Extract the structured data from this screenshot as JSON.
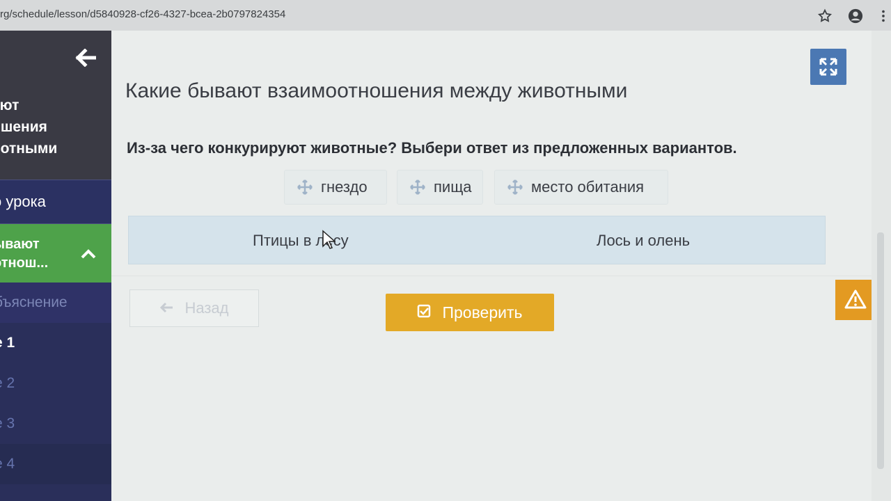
{
  "browser": {
    "url": "rg/schedule/lesson/d5840928-cf26-4327-bcea-2b0797824354",
    "icons": [
      "star-icon",
      "account-icon",
      "menu-icon"
    ]
  },
  "sidebar": {
    "back_icon": "arrow-left-icon",
    "lesson_title_lines": [
      "ают",
      "ошения",
      "вотными"
    ],
    "plan_label": "о урока",
    "active_lines": [
      "ывают",
      "отнош..."
    ],
    "explanation_label": "бъяснение",
    "tasks": [
      "е 1",
      "е 2",
      "е 3",
      "е 4"
    ]
  },
  "main": {
    "heading": "Какие бывают взаимоотношения между животными",
    "question": "Из-за чего конкурируют животные? Выбери ответ из предложенных вариантов.",
    "chips": [
      "гнездо",
      "пища",
      "место обитания"
    ],
    "zones": [
      "Птицы в лесу",
      "Лось и олень"
    ],
    "back_label": "Назад",
    "check_label": "Проверить"
  },
  "colors": {
    "accent_green": "#4ea24a",
    "check_orange": "#e3a927",
    "expand_blue": "#4b78b3",
    "warning_orange": "#e39a22"
  }
}
